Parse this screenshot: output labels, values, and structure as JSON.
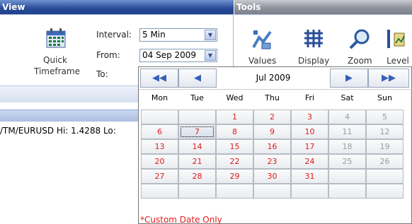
{
  "view_panel": {
    "title": "View",
    "quick_timeframe_label_line1": "Quick",
    "quick_timeframe_label_line2": "Timeframe",
    "interval_label": "Interval:",
    "interval_value": "5 Min",
    "from_label": "From:",
    "from_value": "04 Sep 2009",
    "to_label": "To:"
  },
  "tools_panel": {
    "title": "Tools",
    "items": [
      {
        "label": "Values",
        "icon": "values-icon"
      },
      {
        "label": "Display",
        "icon": "display-icon"
      },
      {
        "label": "Zoom",
        "icon": "zoom-icon"
      },
      {
        "label": "Level",
        "icon": "level-icon"
      }
    ]
  },
  "status": {
    "symbol_text": "/TM/EURUSD  Hi: 1.4288 Lo:"
  },
  "calendar": {
    "month_label": "Jul 2009",
    "nav": {
      "prev_year": "◀◀",
      "prev_month": "◀",
      "next_month": "▶",
      "next_year": "▶▶"
    },
    "weekdays": [
      "Mon",
      "Tue",
      "Wed",
      "Thu",
      "Fri",
      "Sat",
      "Sun"
    ],
    "weeks": [
      [
        "",
        "",
        "1",
        "2",
        "3",
        "4",
        "5"
      ],
      [
        "6",
        "7",
        "8",
        "9",
        "10",
        "11",
        "12"
      ],
      [
        "13",
        "14",
        "15",
        "16",
        "17",
        "18",
        "19"
      ],
      [
        "20",
        "21",
        "22",
        "23",
        "24",
        "25",
        "26"
      ],
      [
        "27",
        "28",
        "29",
        "30",
        "31",
        "",
        ""
      ],
      [
        "",
        "",
        "",
        "",
        "",
        "",
        ""
      ]
    ],
    "selected_day": "7",
    "weekend_color": "#9a9a9a",
    "weekday_color": "#e01b1b",
    "footnote": "*Custom Date Only"
  }
}
